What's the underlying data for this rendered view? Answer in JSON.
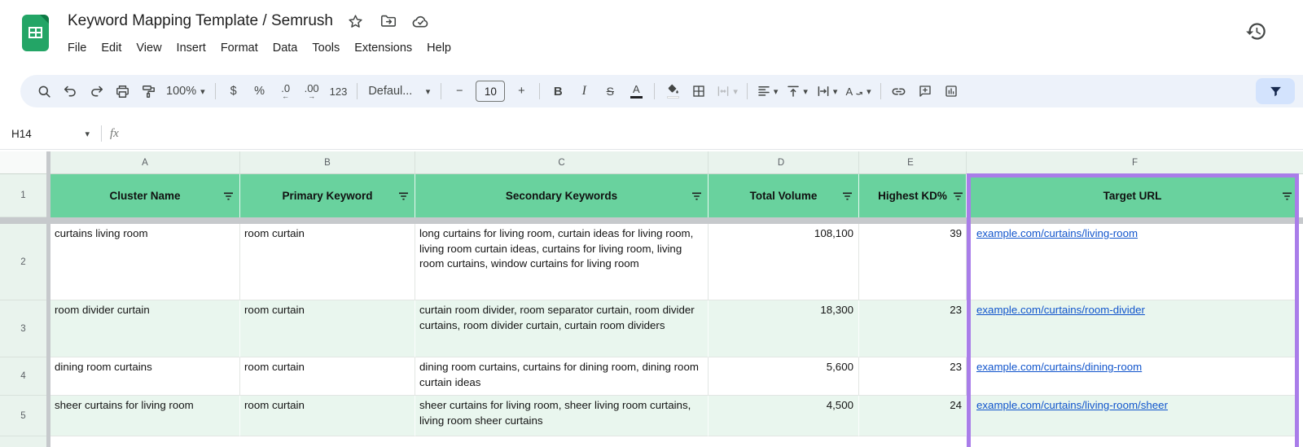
{
  "titlebar": {
    "title": "Keyword Mapping Template / Semrush",
    "icons": [
      "star",
      "move-to-folder",
      "cloud-saved",
      "version-history"
    ]
  },
  "menu": {
    "items": [
      "File",
      "Edit",
      "View",
      "Insert",
      "Format",
      "Data",
      "Tools",
      "Extensions",
      "Help"
    ]
  },
  "toolbar": {
    "zoom_value": "100%",
    "currency": "$",
    "percent": "%",
    "decrease_decimal": ".0",
    "decrease_decimal_arrow": "←",
    "increase_decimal": ".00",
    "increase_decimal_arrow": "→",
    "more_formats": "123",
    "font_name": "Defaul...",
    "decrease_font": "−",
    "font_size": "10",
    "increase_font": "+",
    "bold": "B",
    "italic": "I",
    "strikethrough": "S",
    "text_color": "A",
    "text_rotation": "A"
  },
  "formula_bar": {
    "cell_ref": "H14",
    "fx_label": "fx",
    "value": ""
  },
  "sheet": {
    "column_letters": [
      "A",
      "B",
      "C",
      "D",
      "E",
      "F"
    ],
    "header_row_num": "1",
    "headers": [
      "Cluster Name",
      "Primary Keyword",
      "Secondary Keywords",
      "Total Volume",
      "Highest KD%",
      "Target URL"
    ],
    "rows": [
      {
        "num": "2",
        "cluster": "curtains living room",
        "primary": "room curtain",
        "secondary": "long curtains for living room, curtain ideas for living room, living room curtain ideas, curtains for living room, living room curtains, window curtains for living room",
        "volume": "108,100",
        "kd": "39",
        "url": "example.com/curtains/living-room"
      },
      {
        "num": "3",
        "cluster": "room divider curtain",
        "primary": "room curtain",
        "secondary": "curtain room divider, room separator curtain, room divider curtains, room divider curtain, curtain room dividers",
        "volume": "18,300",
        "kd": "23",
        "url": "example.com/curtains/room-divider"
      },
      {
        "num": "4",
        "cluster": "dining room curtains",
        "primary": "room curtain",
        "secondary": "dining room curtains, curtains for dining room, dining room curtain ideas",
        "volume": "5,600",
        "kd": "23",
        "url": "example.com/curtains/dining-room"
      },
      {
        "num": "5",
        "cluster": "sheer curtains for living room",
        "primary": "room curtain",
        "secondary": "sheer curtains for living room, sheer living room curtains, living room sheer curtains",
        "volume": "4,500",
        "kd": "24",
        "url": "example.com/curtains/living-room/sheer"
      }
    ]
  },
  "colors": {
    "header_green": "#69d29e",
    "band_green": "#e9f6ee",
    "chrome_green": "#e9f3ed",
    "column_highlight_purple": "#a97de9",
    "link_blue": "#1155cc",
    "toolbar_bg": "#edf2fa",
    "filter_active_bg": "#d3e3fd",
    "logo_green": "#23a566"
  }
}
